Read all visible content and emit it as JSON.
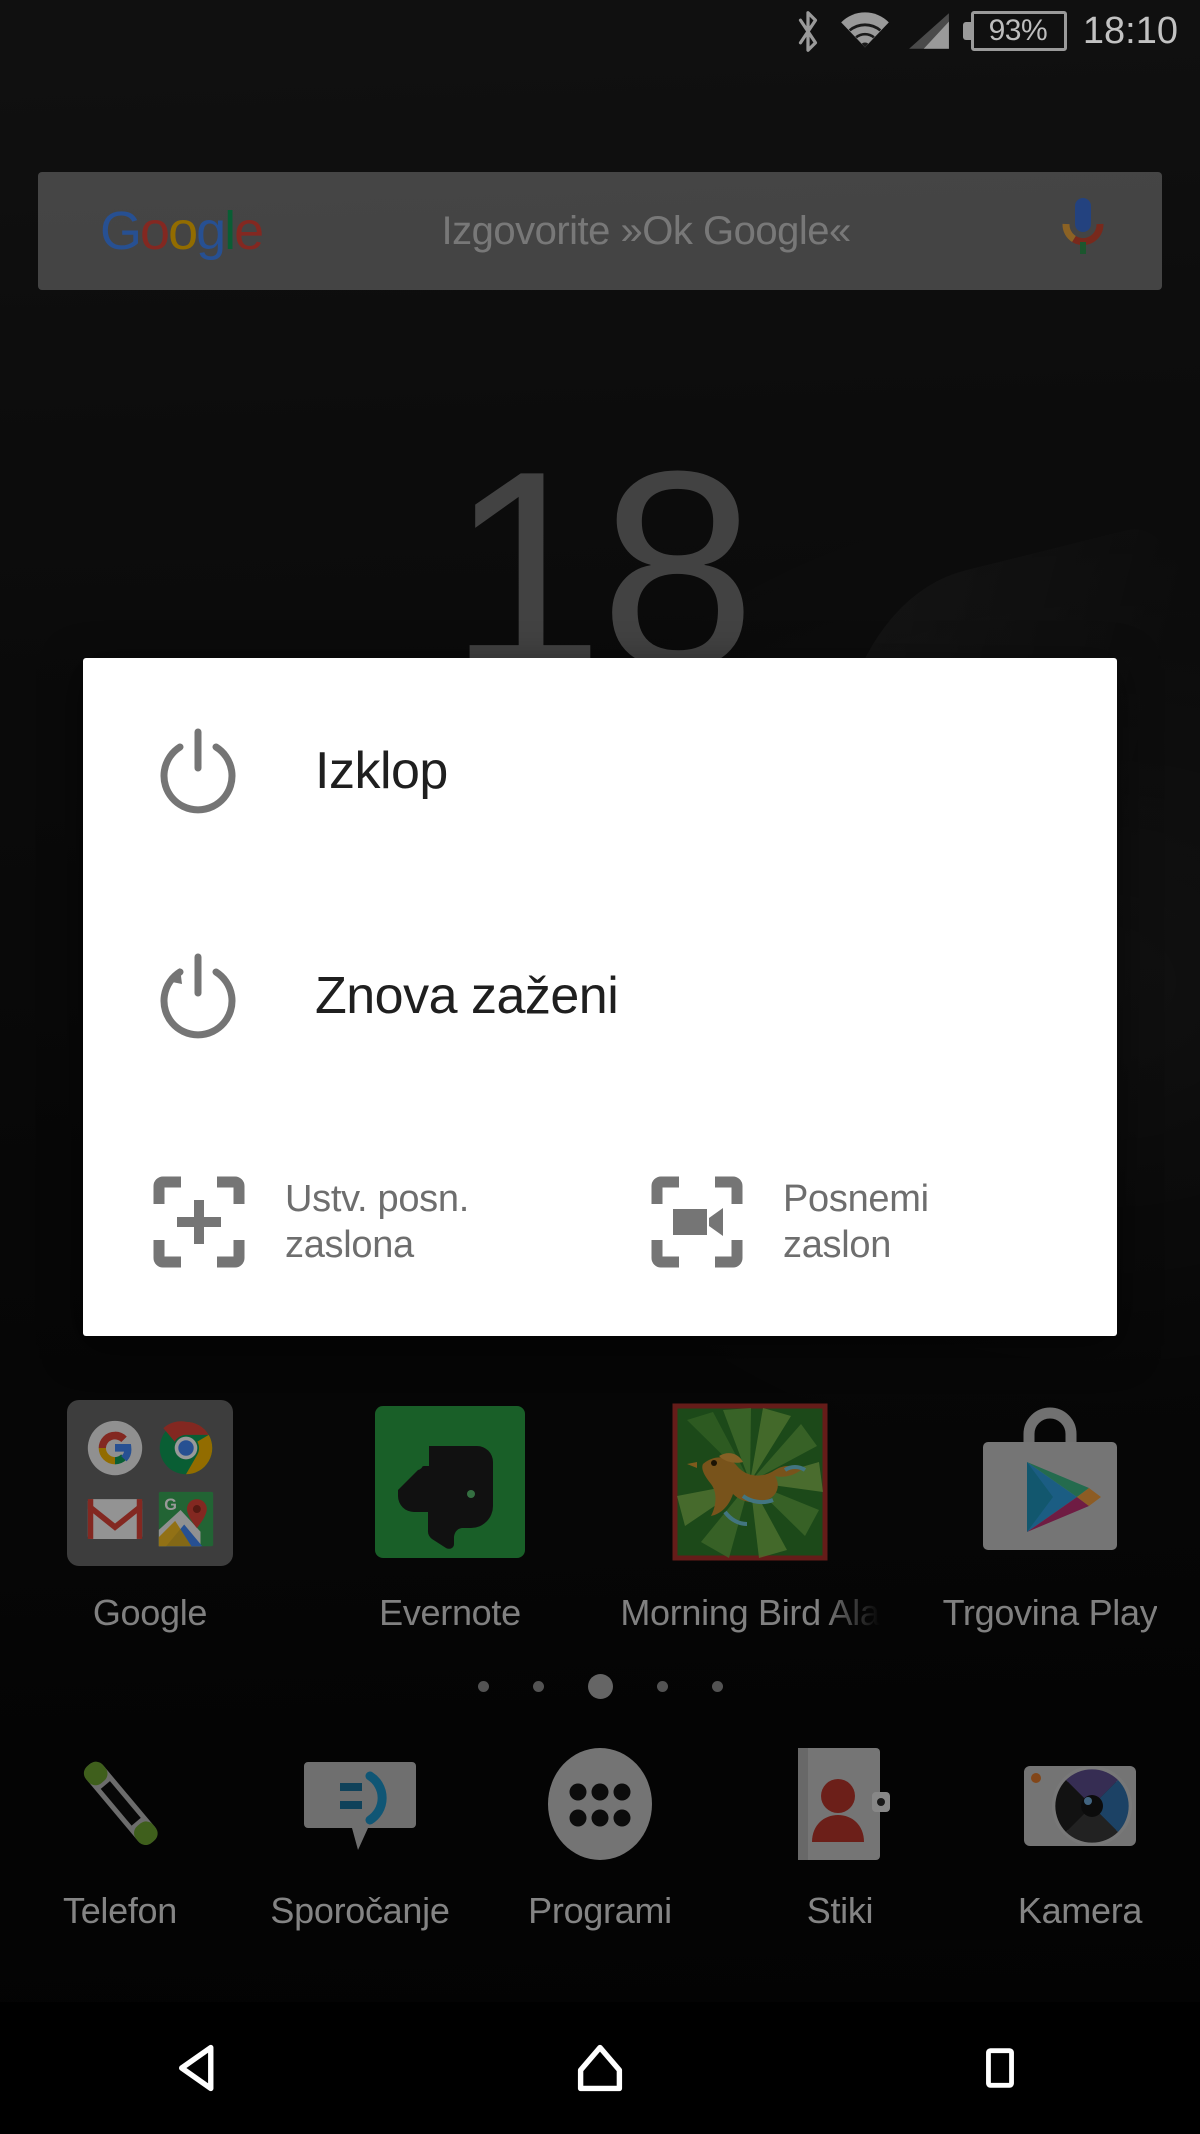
{
  "status_bar": {
    "bluetooth_icon": "bluetooth-icon",
    "wifi_icon": "wifi-icon",
    "signal_icon": "cellular-signal-icon",
    "battery_icon": "battery-icon",
    "battery_level": "93%",
    "time": "18:10"
  },
  "search_widget": {
    "logo": "Google",
    "logo_letters": [
      "G",
      "o",
      "o",
      "g",
      "l",
      "e"
    ],
    "hint": "Izgovorite »Ok Google«",
    "mic_icon": "microphone-icon"
  },
  "clock_widget": {
    "hour": "18"
  },
  "power_dialog": {
    "items": [
      {
        "label": "Izklop",
        "icon": "power-icon"
      },
      {
        "label": "Znova zaženi",
        "icon": "restart-icon"
      }
    ],
    "split_items": [
      {
        "label": "Ustv. posn. zaslona",
        "icon": "screenshot-icon"
      },
      {
        "label": "Posnemi zaslon",
        "icon": "screen-record-icon"
      }
    ]
  },
  "home_screen": {
    "apps": [
      {
        "label": "Google",
        "icon": "google-folder-icon",
        "truncated": false
      },
      {
        "label": "Evernote",
        "icon": "evernote-icon",
        "truncated": false
      },
      {
        "label": "Morning Bird Ala",
        "icon": "morning-bird-alarm-icon",
        "truncated": true
      },
      {
        "label": "Trgovina Play",
        "icon": "play-store-icon",
        "truncated": false
      }
    ],
    "page_dots": {
      "count": 5,
      "active_index": 2
    }
  },
  "dock": {
    "items": [
      {
        "label": "Telefon",
        "icon": "phone-icon"
      },
      {
        "label": "Sporočanje",
        "icon": "messaging-icon"
      },
      {
        "label": "Programi",
        "icon": "app-drawer-icon"
      },
      {
        "label": "Stiki",
        "icon": "contacts-icon"
      },
      {
        "label": "Kamera",
        "icon": "camera-icon"
      }
    ]
  },
  "nav_bar": {
    "back_label": "back-icon",
    "home_label": "home-icon",
    "recents_label": "recents-icon"
  },
  "colors": {
    "dialog_bg": "#ffffff",
    "dialog_title": "#1f1f1f",
    "dialog_secondary": "#6e6e6e",
    "icon_gray": "#757575",
    "status_text": "#c2c2c2",
    "google_blue": "#4285F4",
    "google_red": "#DB4437",
    "google_yellow": "#F4B400",
    "google_green": "#0F9D58",
    "evernote_green": "#2dbe60"
  }
}
